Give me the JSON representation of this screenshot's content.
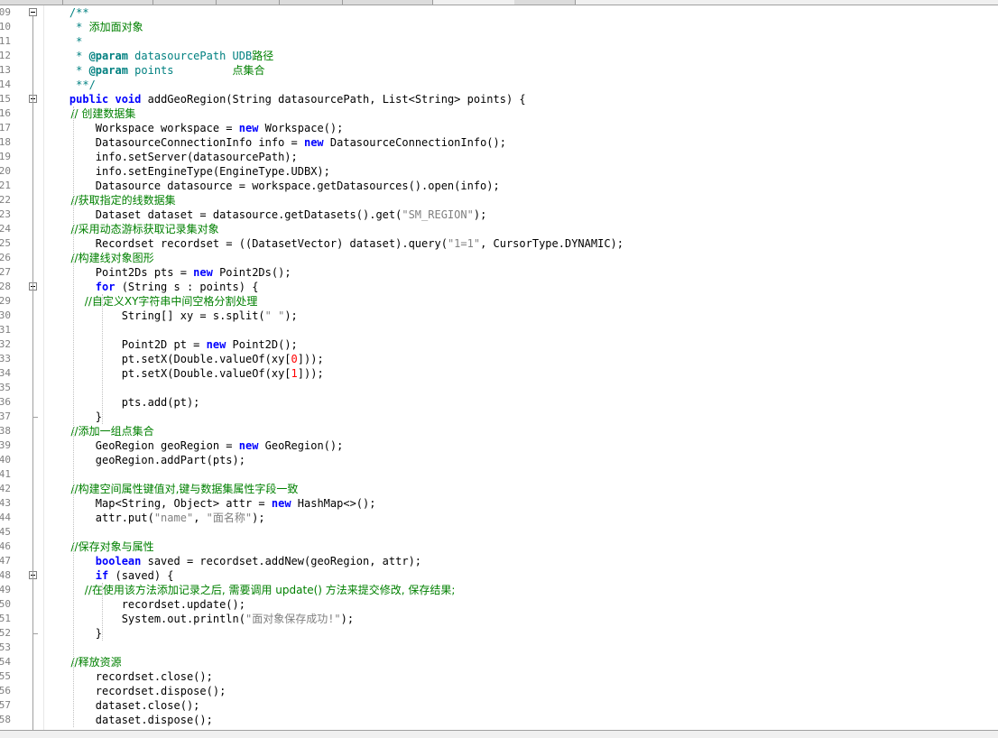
{
  "editor": {
    "colors": {
      "comment": "#008000",
      "javadoc": "#008080",
      "keyword": "#0000ff",
      "string": "#808080",
      "number": "#ff0000",
      "plain": "#000000"
    },
    "lines": [
      {
        "num": "09",
        "fold": "box",
        "segments": [
          {
            "t": "    /**",
            "c": "doc"
          }
        ]
      },
      {
        "num": "10",
        "segments": [
          {
            "t": "     * ",
            "c": "doc"
          },
          {
            "t": "添加面对象",
            "c": "comment"
          }
        ]
      },
      {
        "num": "11",
        "segments": [
          {
            "t": "     *",
            "c": "doc"
          }
        ]
      },
      {
        "num": "12",
        "segments": [
          {
            "t": "     * ",
            "c": "doc"
          },
          {
            "t": "@param",
            "c": "doctag"
          },
          {
            "t": " datasourcePath UDB",
            "c": "doc"
          },
          {
            "t": "路径",
            "c": "comment"
          }
        ]
      },
      {
        "num": "13",
        "segments": [
          {
            "t": "     * ",
            "c": "doc"
          },
          {
            "t": "@param",
            "c": "doctag"
          },
          {
            "t": " points         ",
            "c": "doc"
          },
          {
            "t": "点集合",
            "c": "comment"
          }
        ]
      },
      {
        "num": "14",
        "segments": [
          {
            "t": "     **/",
            "c": "doc"
          }
        ]
      },
      {
        "num": "15",
        "fold": "box",
        "segments": [
          {
            "t": "    ",
            "c": "plain"
          },
          {
            "t": "public void",
            "c": "kw"
          },
          {
            "t": " addGeoRegion(String datasourcePath, List<String> points) {",
            "c": "plain"
          }
        ]
      },
      {
        "num": "16",
        "segments": [
          {
            "t": "        // ",
            "c": "comment"
          },
          {
            "t": "创建数据集",
            "c": "comment"
          }
        ]
      },
      {
        "num": "17",
        "segments": [
          {
            "t": "        Workspace workspace = ",
            "c": "plain"
          },
          {
            "t": "new",
            "c": "kw"
          },
          {
            "t": " Workspace();",
            "c": "plain"
          }
        ]
      },
      {
        "num": "18",
        "segments": [
          {
            "t": "        DatasourceConnectionInfo info = ",
            "c": "plain"
          },
          {
            "t": "new",
            "c": "kw"
          },
          {
            "t": " DatasourceConnectionInfo();",
            "c": "plain"
          }
        ]
      },
      {
        "num": "19",
        "segments": [
          {
            "t": "        info.setServer(datasourcePath);",
            "c": "plain"
          }
        ]
      },
      {
        "num": "20",
        "segments": [
          {
            "t": "        info.setEngineType(EngineType.UDBX);",
            "c": "plain"
          }
        ]
      },
      {
        "num": "21",
        "segments": [
          {
            "t": "        Datasource datasource = workspace.getDatasources().open(info);",
            "c": "plain"
          }
        ]
      },
      {
        "num": "22",
        "segments": [
          {
            "t": "        //",
            "c": "comment"
          },
          {
            "t": "获取指定的线数据集",
            "c": "comment"
          }
        ]
      },
      {
        "num": "23",
        "segments": [
          {
            "t": "        Dataset dataset = datasource.getDatasets().get(",
            "c": "plain"
          },
          {
            "t": "\"SM_REGION\"",
            "c": "str"
          },
          {
            "t": ");",
            "c": "plain"
          }
        ]
      },
      {
        "num": "24",
        "segments": [
          {
            "t": "        //",
            "c": "comment"
          },
          {
            "t": "采用动态游标获取记录集对象",
            "c": "comment"
          }
        ]
      },
      {
        "num": "25",
        "segments": [
          {
            "t": "        Recordset recordset = ((DatasetVector) dataset).query(",
            "c": "plain"
          },
          {
            "t": "\"1=1\"",
            "c": "str"
          },
          {
            "t": ", CursorType.DYNAMIC);",
            "c": "plain"
          }
        ]
      },
      {
        "num": "26",
        "segments": [
          {
            "t": "        //",
            "c": "comment"
          },
          {
            "t": "构建线对象图形",
            "c": "comment"
          }
        ]
      },
      {
        "num": "27",
        "segments": [
          {
            "t": "        Point2Ds pts = ",
            "c": "plain"
          },
          {
            "t": "new",
            "c": "kw"
          },
          {
            "t": " Point2Ds();",
            "c": "plain"
          }
        ]
      },
      {
        "num": "28",
        "fold": "box",
        "segments": [
          {
            "t": "        ",
            "c": "plain"
          },
          {
            "t": "for",
            "c": "kw"
          },
          {
            "t": " (String s : points) {",
            "c": "plain"
          }
        ]
      },
      {
        "num": "29",
        "segments": [
          {
            "t": "            //",
            "c": "comment"
          },
          {
            "t": "自定义XY字符串中间空格分割处理",
            "c": "comment"
          }
        ]
      },
      {
        "num": "30",
        "segments": [
          {
            "t": "            String[] xy = s.split(",
            "c": "plain"
          },
          {
            "t": "\" \"",
            "c": "str"
          },
          {
            "t": ");",
            "c": "plain"
          }
        ]
      },
      {
        "num": "31",
        "segments": []
      },
      {
        "num": "32",
        "segments": [
          {
            "t": "            Point2D pt = ",
            "c": "plain"
          },
          {
            "t": "new",
            "c": "kw"
          },
          {
            "t": " Point2D();",
            "c": "plain"
          }
        ]
      },
      {
        "num": "33",
        "segments": [
          {
            "t": "            pt.setX(Double.valueOf(xy[",
            "c": "plain"
          },
          {
            "t": "0",
            "c": "num"
          },
          {
            "t": "]));",
            "c": "plain"
          }
        ]
      },
      {
        "num": "34",
        "segments": [
          {
            "t": "            pt.setX(Double.valueOf(xy[",
            "c": "plain"
          },
          {
            "t": "1",
            "c": "num"
          },
          {
            "t": "]));",
            "c": "plain"
          }
        ]
      },
      {
        "num": "35",
        "segments": []
      },
      {
        "num": "36",
        "segments": [
          {
            "t": "            pts.add(pt);",
            "c": "plain"
          }
        ]
      },
      {
        "num": "37",
        "fold": "end",
        "segments": [
          {
            "t": "        }",
            "c": "plain"
          }
        ]
      },
      {
        "num": "38",
        "segments": [
          {
            "t": "        //",
            "c": "comment"
          },
          {
            "t": "添加一组点集合",
            "c": "comment"
          }
        ]
      },
      {
        "num": "39",
        "segments": [
          {
            "t": "        GeoRegion geoRegion = ",
            "c": "plain"
          },
          {
            "t": "new",
            "c": "kw"
          },
          {
            "t": " GeoRegion();",
            "c": "plain"
          }
        ]
      },
      {
        "num": "40",
        "segments": [
          {
            "t": "        geoRegion.addPart(pts);",
            "c": "plain"
          }
        ]
      },
      {
        "num": "41",
        "segments": []
      },
      {
        "num": "42",
        "segments": [
          {
            "t": "        //",
            "c": "comment"
          },
          {
            "t": "构建空间属性键值对,键与数据集属性字段一致",
            "c": "comment"
          }
        ]
      },
      {
        "num": "43",
        "segments": [
          {
            "t": "        Map<String, Object> attr = ",
            "c": "plain"
          },
          {
            "t": "new",
            "c": "kw"
          },
          {
            "t": " HashMap<>();",
            "c": "plain"
          }
        ]
      },
      {
        "num": "44",
        "segments": [
          {
            "t": "        attr.put(",
            "c": "plain"
          },
          {
            "t": "\"name\"",
            "c": "str"
          },
          {
            "t": ", ",
            "c": "plain"
          },
          {
            "t": "\"面名称\"",
            "c": "str"
          },
          {
            "t": ");",
            "c": "plain"
          }
        ]
      },
      {
        "num": "45",
        "segments": []
      },
      {
        "num": "46",
        "segments": [
          {
            "t": "        //",
            "c": "comment"
          },
          {
            "t": "保存对象与属性",
            "c": "comment"
          }
        ]
      },
      {
        "num": "47",
        "segments": [
          {
            "t": "        ",
            "c": "plain"
          },
          {
            "t": "boolean",
            "c": "kw"
          },
          {
            "t": " saved = recordset.addNew(geoRegion, attr);",
            "c": "plain"
          }
        ]
      },
      {
        "num": "48",
        "fold": "box",
        "segments": [
          {
            "t": "        ",
            "c": "plain"
          },
          {
            "t": "if",
            "c": "kw"
          },
          {
            "t": " (saved) {",
            "c": "plain"
          }
        ]
      },
      {
        "num": "49",
        "segments": [
          {
            "t": "            //",
            "c": "comment"
          },
          {
            "t": "在使用该方法添加记录之后, 需要调用 update() 方法来提交修改, 保存结果;",
            "c": "comment"
          }
        ]
      },
      {
        "num": "50",
        "segments": [
          {
            "t": "            recordset.update();",
            "c": "plain"
          }
        ]
      },
      {
        "num": "51",
        "segments": [
          {
            "t": "            System.out.println(",
            "c": "plain"
          },
          {
            "t": "\"面对象保存成功!\"",
            "c": "str"
          },
          {
            "t": ");",
            "c": "plain"
          }
        ]
      },
      {
        "num": "52",
        "fold": "end",
        "segments": [
          {
            "t": "        }",
            "c": "plain"
          }
        ]
      },
      {
        "num": "53",
        "segments": []
      },
      {
        "num": "54",
        "segments": [
          {
            "t": "        //",
            "c": "comment"
          },
          {
            "t": "释放资源",
            "c": "comment"
          }
        ]
      },
      {
        "num": "55",
        "segments": [
          {
            "t": "        recordset.close();",
            "c": "plain"
          }
        ]
      },
      {
        "num": "56",
        "segments": [
          {
            "t": "        recordset.dispose();",
            "c": "plain"
          }
        ]
      },
      {
        "num": "57",
        "segments": [
          {
            "t": "        dataset.close();",
            "c": "plain"
          }
        ]
      },
      {
        "num": "58",
        "segments": [
          {
            "t": "        dataset.dispose();",
            "c": "plain"
          }
        ]
      }
    ]
  }
}
